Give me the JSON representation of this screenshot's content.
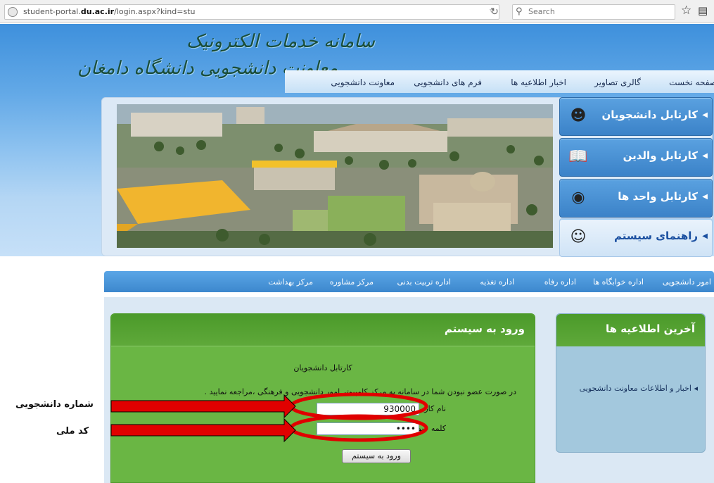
{
  "browser": {
    "url_prefix": "student-portal.",
    "url_domain": "du.ac.ir",
    "url_path": "/login.aspx?kind=stu",
    "search_placeholder": "Search"
  },
  "header": {
    "logo_line1": "سامانه خدمات الکترونیک",
    "logo_line2": "معاونت دانشجویی دانشگاه دامغان",
    "nav": [
      "صفحه نخست",
      "گالری تصاویر",
      "اخبار اطلاعیه ها",
      "فرم های دانشجویی",
      "معاونت دانشجویی"
    ]
  },
  "side_menu": [
    {
      "label": "کارتابل دانشجویان",
      "icon": "students-icon"
    },
    {
      "label": "کارتابل والدین",
      "icon": "parents-book-icon"
    },
    {
      "label": "کارتابل واحد ها",
      "icon": "units-icon"
    },
    {
      "label": "راهنمای سیستم",
      "icon": "help-users-icon"
    }
  ],
  "secondary_nav": [
    "امور دانشجویی",
    "اداره خوابگاه ها",
    "اداره رفاه",
    "اداره تغذیه",
    "اداره تربیت بدنی",
    "مرکز مشاوره",
    "مرکز بهداشت"
  ],
  "login": {
    "title": "ورود به سیستم",
    "subtitle": "کارتابل دانشجویان",
    "note": "در صورت عضو نبودن شما در سامانه به مرکز کامپیوتر امور دانشجویی و فرهنگی ،مراجعه نمایید .",
    "username_label": "نام کاربری :",
    "username_value": "930000",
    "password_label": "کلمه عبور :",
    "password_value": "••••",
    "submit_label": "ورود به سیستم"
  },
  "news": {
    "title": "آخرین اطلاعیه ها",
    "items": [
      "اخبار و اطلاعات معاونت دانشجویی"
    ]
  },
  "annotations": {
    "student_number": "شماره دانشجویی",
    "national_code": "کد ملی"
  },
  "colors": {
    "header_blue": "#3e90dc",
    "login_green": "#6ab644",
    "annotation_red": "#e00000"
  }
}
